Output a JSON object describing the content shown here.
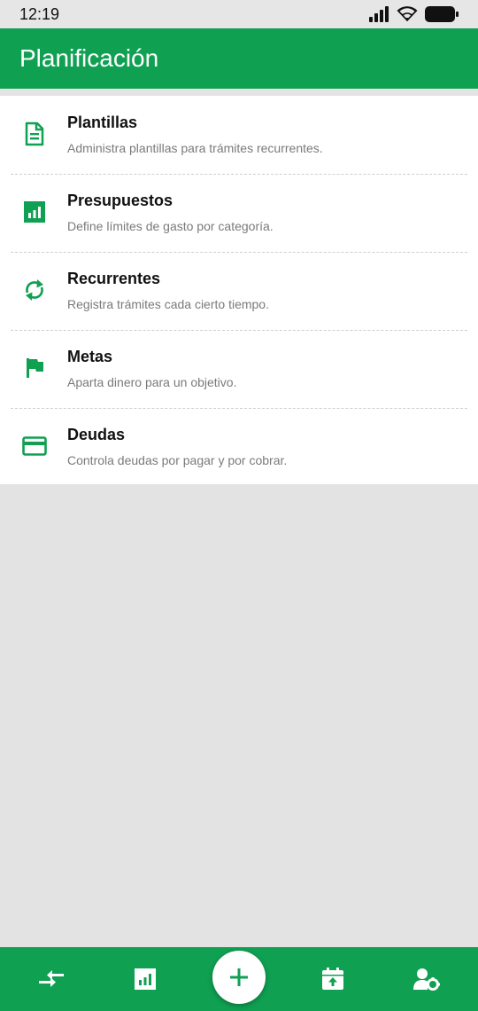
{
  "status_bar": {
    "time": "12:19"
  },
  "app_bar": {
    "title": "Planificación"
  },
  "items": [
    {
      "title": "Plantillas",
      "subtitle": "Administra plantillas para trámites recurrentes.",
      "icon": "document-icon"
    },
    {
      "title": "Presupuestos",
      "subtitle": "Define límites de gasto por categoría.",
      "icon": "bar-chart-icon"
    },
    {
      "title": "Recurrentes",
      "subtitle": "Registra trámites cada cierto tiempo.",
      "icon": "refresh-icon"
    },
    {
      "title": "Metas",
      "subtitle": "Aparta dinero para un objetivo.",
      "icon": "flag-icon"
    },
    {
      "title": "Deudas",
      "subtitle": "Controla deudas por pagar y por cobrar.",
      "icon": "credit-card-icon"
    }
  ],
  "colors": {
    "primary": "#10a052",
    "background": "#e3e3e3",
    "surface": "#ffffff"
  },
  "bottom_nav": [
    "transfer-icon",
    "bar-chart-icon",
    "add-icon",
    "calendar-upload-icon",
    "user-settings-icon"
  ]
}
